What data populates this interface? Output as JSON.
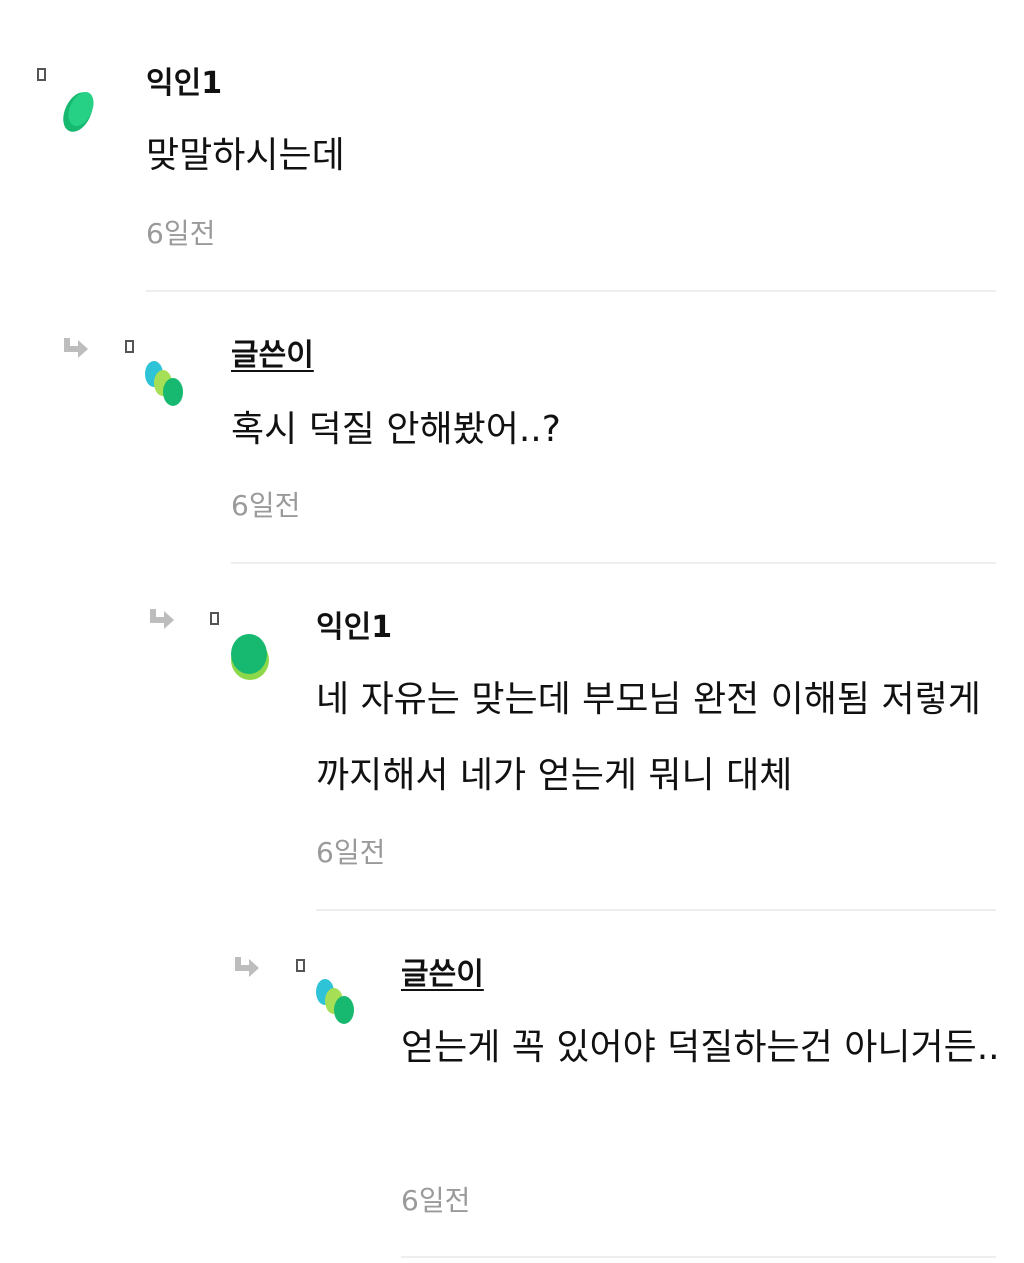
{
  "comments": [
    {
      "author": "익인1",
      "is_op": false,
      "content": "맞말하시는데",
      "time": "6일전",
      "avatar": "green-leaf-avatar"
    },
    {
      "author": "글쓴이",
      "is_op": true,
      "content": "혹시 덕질 안해봤어..?",
      "time": "6일전",
      "avatar": "tricolor-dots-avatar"
    },
    {
      "author": "익인1",
      "is_op": false,
      "content": "네 자유는 맞는데 부모님 완전 이해됨 저렇게까지해서 네가 얻는게 뭐니 대체",
      "time": "6일전",
      "avatar": "green-lime-avatar"
    },
    {
      "author": "글쓴이",
      "is_op": true,
      "content": "얻는게 꼭 있어야 덕질하는건 아니거든..",
      "time": "6일전",
      "avatar": "tricolor-dots-avatar"
    }
  ],
  "icons": {
    "reply": "reply-arrow-icon",
    "marker": "small-square-icon"
  },
  "colors": {
    "avatar_green": "#1DC77E",
    "avatar_lime": "#8DD84A",
    "avatar_cyan": "#2EC3D6",
    "time_gray": "#9A9A9A",
    "divider": "#EEEEEE"
  }
}
